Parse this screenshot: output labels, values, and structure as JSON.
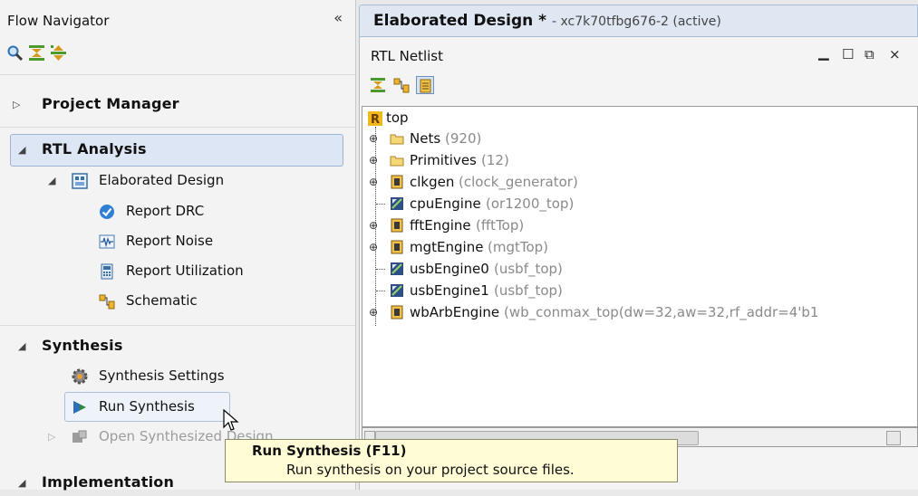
{
  "flow_navigator": {
    "title": "Flow Navigator",
    "collapse_glyph": "«",
    "toolbar_icons": [
      "search-icon",
      "collapse-all-icon",
      "expand-all-icon"
    ],
    "sections": {
      "project_manager": {
        "label": "Project Manager",
        "expanded": false
      },
      "rtl_analysis": {
        "label": "RTL Analysis",
        "expanded": true,
        "elaborated_design": "Elaborated Design",
        "items": [
          "Report DRC",
          "Report Noise",
          "Report Utilization",
          "Schematic"
        ]
      },
      "synthesis": {
        "label": "Synthesis",
        "expanded": true,
        "items": [
          "Synthesis Settings",
          "Run Synthesis",
          "Open Synthesized Design"
        ]
      },
      "implementation": {
        "label": "Implementation",
        "expanded": true
      }
    }
  },
  "design_tab": {
    "title": "Elaborated Design *",
    "subtitle": "- xc7k70tfbg676-2  (active)"
  },
  "rtl_netlist": {
    "title": "RTL Netlist",
    "window_buttons": [
      "minimize-icon",
      "maximize-icon",
      "restore-icon",
      "close-icon"
    ],
    "toolbar_icons": [
      "collapse-all-icon",
      "schematic-icon",
      "show-selection-icon"
    ],
    "root": "top",
    "nodes": [
      {
        "name": "Nets",
        "detail": "(920)",
        "type": "folder",
        "expandable": true
      },
      {
        "name": "Primitives",
        "detail": "(12)",
        "type": "folder",
        "expandable": true
      },
      {
        "name": "clkgen",
        "detail": "(clock_generator)",
        "type": "module",
        "expandable": true
      },
      {
        "name": "cpuEngine",
        "detail": "(or1200_top)",
        "type": "blackbox",
        "expandable": false
      },
      {
        "name": "fftEngine",
        "detail": "(fftTop)",
        "type": "module",
        "expandable": true
      },
      {
        "name": "mgtEngine",
        "detail": "(mgtTop)",
        "type": "module",
        "expandable": true
      },
      {
        "name": "usbEngine0",
        "detail": "(usbf_top)",
        "type": "blackbox",
        "expandable": false
      },
      {
        "name": "usbEngine1",
        "detail": "(usbf_top)",
        "type": "blackbox",
        "expandable": false
      },
      {
        "name": "wbArbEngine",
        "detail": "(wb_conmax_top(dw=32,aw=32,rf_addr=4'b1",
        "type": "module",
        "expandable": true
      }
    ]
  },
  "tooltip": {
    "title": "Run Synthesis (F11)",
    "description": "Run synthesis on your project source files."
  },
  "colors": {
    "selection_fill": "#dce6f4",
    "selection_border": "#9db4d4",
    "tooltip_bg": "#fffcd6"
  }
}
